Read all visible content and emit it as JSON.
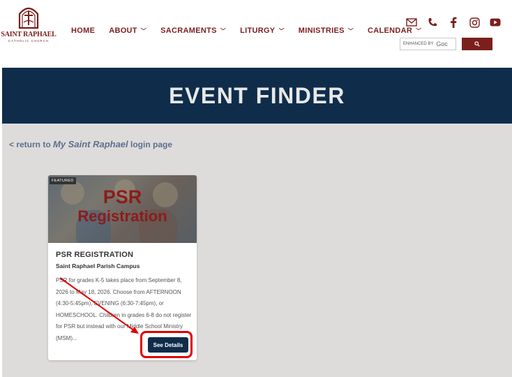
{
  "site": {
    "logo_title": "SAINT RAPHAEL",
    "logo_subtitle": "CATHOLIC CHURCH"
  },
  "nav": {
    "items": [
      {
        "label": "HOME",
        "has_dropdown": false
      },
      {
        "label": "ABOUT",
        "has_dropdown": true
      },
      {
        "label": "SACRAMENTS",
        "has_dropdown": true
      },
      {
        "label": "LITURGY",
        "has_dropdown": true
      },
      {
        "label": "MINISTRIES",
        "has_dropdown": true
      },
      {
        "label": "CALENDAR",
        "has_dropdown": true
      }
    ]
  },
  "social": {
    "icons": [
      "mail-icon",
      "phone-icon",
      "facebook-icon",
      "instagram-icon",
      "youtube-icon"
    ]
  },
  "search": {
    "enhanced_by": "ENHANCED BY",
    "google_text": "Goc"
  },
  "hero": {
    "title": "EVENT FINDER"
  },
  "back_link": {
    "prefix": "< return to",
    "emphasis": "My Saint Raphael",
    "suffix": "login page"
  },
  "card": {
    "badge": "FEATURED",
    "image_line1": "PSR",
    "image_line2": "Registration",
    "title": "PSR REGISTRATION",
    "location": "Saint Raphael Parish Campus",
    "description": "PSR for grades K-5 takes place from September 8, 2026 to May 18, 2026. Choose from AFTERNOON (4:30-5:45pm), EVENING (6:30-7:45pm), or HOMESCHOOL. Children in grades 6-8 do not register for PSR but instead with our Middle School Ministry (MSM)...",
    "button_label": "See Details"
  },
  "colors": {
    "brand": "#7a1f1c",
    "navy": "#0f2d4a",
    "annotation": "#e00000"
  }
}
